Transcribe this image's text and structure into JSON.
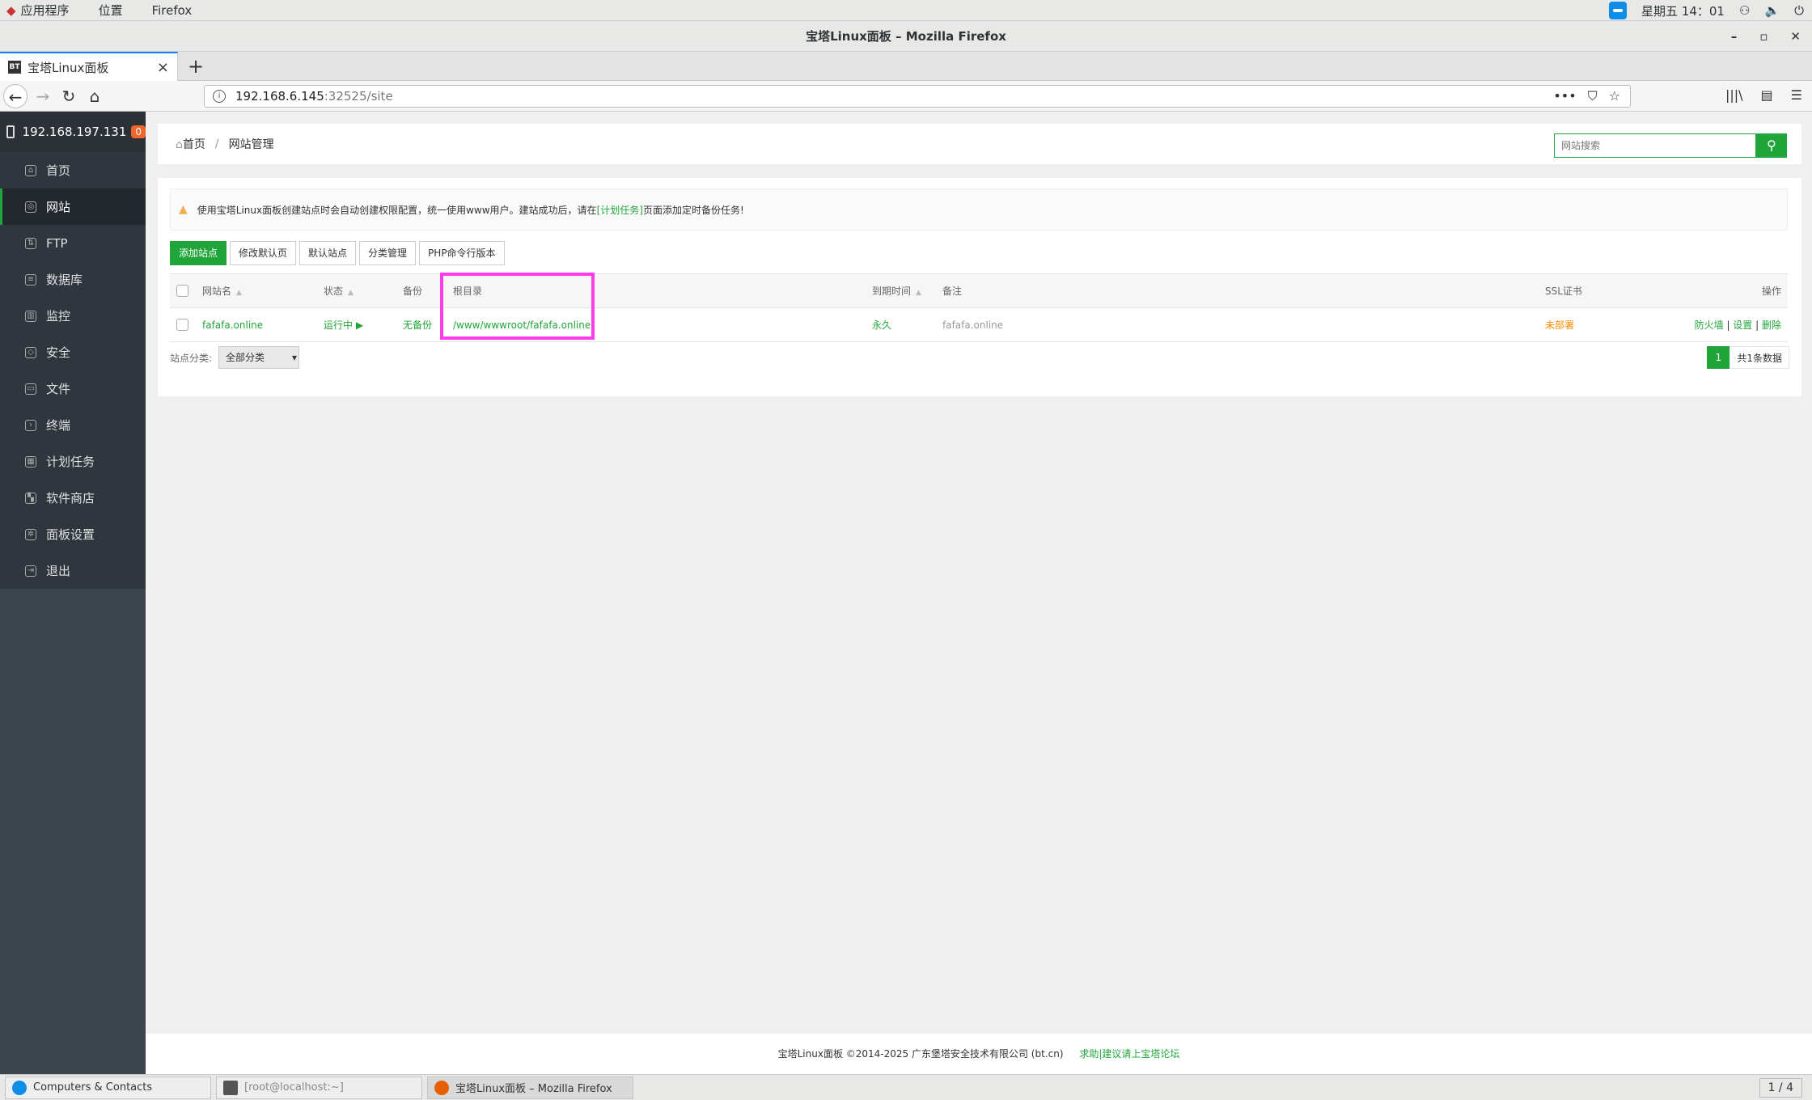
{
  "gnome": {
    "menu_apps": "应用程序",
    "menu_places": "位置",
    "menu_firefox": "Firefox",
    "clock": "星期五 14：01"
  },
  "window": {
    "title": "宝塔Linux面板 – Mozilla Firefox"
  },
  "tab": {
    "favicon": "BT",
    "title": "宝塔Linux面板"
  },
  "url": {
    "host": "192.168.6.145",
    "path": ":32525/site"
  },
  "sidebar": {
    "server_ip": "192.168.197.131",
    "badge": "0",
    "items": [
      {
        "label": "首页",
        "icon": "home-icon"
      },
      {
        "label": "网站",
        "icon": "globe-icon"
      },
      {
        "label": "FTP",
        "icon": "ftp-icon"
      },
      {
        "label": "数据库",
        "icon": "database-icon"
      },
      {
        "label": "监控",
        "icon": "monitor-icon"
      },
      {
        "label": "安全",
        "icon": "shield-icon"
      },
      {
        "label": "文件",
        "icon": "folder-icon"
      },
      {
        "label": "终端",
        "icon": "terminal-icon"
      },
      {
        "label": "计划任务",
        "icon": "calendar-icon"
      },
      {
        "label": "软件商店",
        "icon": "grid-icon"
      },
      {
        "label": "面板设置",
        "icon": "gear-icon"
      },
      {
        "label": "退出",
        "icon": "logout-icon"
      }
    ],
    "active_index": 1
  },
  "breadcrumb": {
    "home": "首页",
    "sep": "/",
    "current": "网站管理"
  },
  "search": {
    "placeholder": "网站搜索"
  },
  "alert": {
    "text_before": "使用宝塔Linux面板创建站点时会自动创建权限配置，统一使用www用户。建站成功后，请在",
    "link": "[计划任务]",
    "text_after": "页面添加定时备份任务!"
  },
  "buttons": {
    "add_site": "添加站点",
    "modify_default": "修改默认页",
    "default_site": "默认站点",
    "category": "分类管理",
    "php_cli": "PHP命令行版本"
  },
  "table": {
    "headers": {
      "name": "网站名",
      "status": "状态",
      "backup": "备份",
      "root": "根目录",
      "expire": "到期时间",
      "note": "备注",
      "ssl": "SSL证书",
      "ops": "操作"
    },
    "rows": [
      {
        "name": "fafafa.online",
        "status": "运行中 ▶",
        "backup": "无备份",
        "root": "/www/wwwroot/fafafa.online",
        "expire": "永久",
        "note": "fafafa.online",
        "ssl": "未部署",
        "op_firewall": "防火墙",
        "op_sep1": " | ",
        "op_settings": "设置",
        "op_sep2": " | ",
        "op_delete": "删除"
      }
    ]
  },
  "filter": {
    "label": "站点分类:",
    "selected": "全部分类"
  },
  "pager": {
    "page": "1",
    "total": "共1条数据"
  },
  "footer": {
    "copyright": "宝塔Linux面板 ©2014-2025 广东堡塔安全技术有限公司 (bt.cn)",
    "link": "求助|建议请上宝塔论坛"
  },
  "taskbar": {
    "t1": "Computers & Contacts",
    "t2": "[root@localhost:~]",
    "t3": "宝塔Linux面板 – Mozilla Firefox",
    "pages": "1 / 4"
  },
  "colors": {
    "brand_green": "#20a53a",
    "sidebar_bg": "#3c444d",
    "highlight": "#ff3cea",
    "warning": "#fb8c00"
  }
}
